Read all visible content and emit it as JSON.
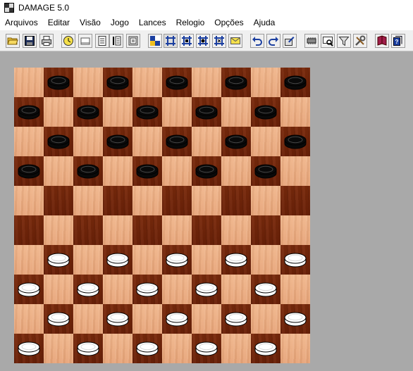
{
  "window": {
    "title": "DAMAGE 5.0"
  },
  "menu": [
    "Arquivos",
    "Editar",
    "Visão",
    "Jogo",
    "Lances",
    "Relogio",
    "Opções",
    "Ajuda"
  ],
  "toolbar": {
    "buttons": [
      {
        "icon": "open-folder-icon"
      },
      {
        "icon": "save-icon"
      },
      {
        "icon": "print-icon"
      },
      {
        "icon": "clock-icon"
      },
      {
        "icon": "blank-card-icon"
      },
      {
        "icon": "notes-icon"
      },
      {
        "icon": "move-list-icon"
      },
      {
        "icon": "document-icon"
      },
      {
        "icon": "board-setup-icon"
      },
      {
        "icon": "grid-mode-1-icon"
      },
      {
        "icon": "grid-mode-2-icon"
      },
      {
        "icon": "grid-mode-3-icon"
      },
      {
        "icon": "grid-mode-4-icon"
      },
      {
        "icon": "message-icon"
      },
      {
        "icon": "undo-icon"
      },
      {
        "icon": "redo-icon"
      },
      {
        "icon": "setup-icon"
      },
      {
        "icon": "engine-icon"
      },
      {
        "icon": "analysis-icon"
      },
      {
        "icon": "filter-icon"
      },
      {
        "icon": "tools-icon"
      },
      {
        "icon": "book-icon"
      },
      {
        "icon": "help-icon"
      }
    ]
  },
  "board": {
    "size": 10,
    "rows": [
      ".b.b.b.b.b",
      "b.b.b.b.b.",
      ".b.b.b.b.b",
      "b.b.b.b.b.",
      "..........",
      "..........",
      ".w.w.w.w.w",
      "w.w.w.w.w.",
      ".w.w.w.w.w",
      "w.w.w.w.w."
    ],
    "colors": {
      "light": "#e9a87b",
      "dark": "#722509",
      "black_piece": "#0a0a0a",
      "white_piece": "#ffffff"
    }
  }
}
